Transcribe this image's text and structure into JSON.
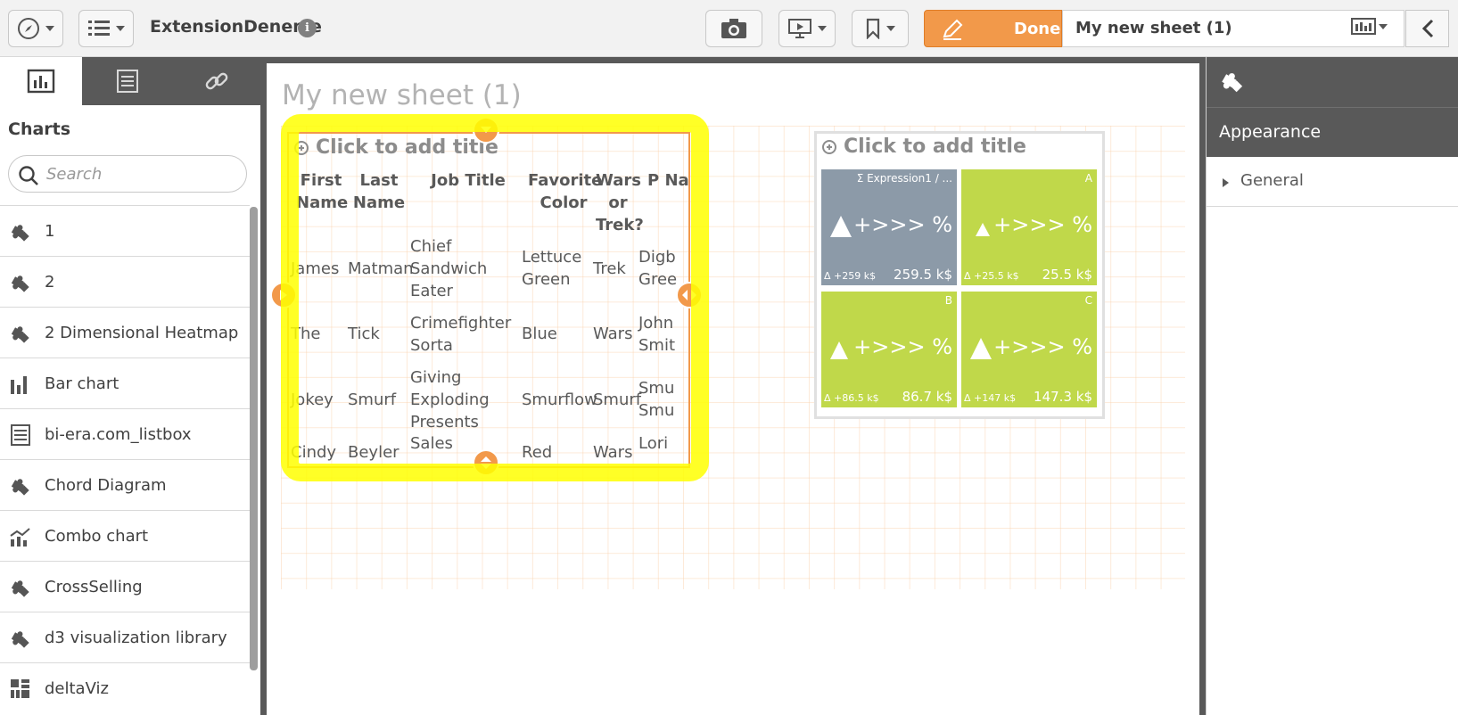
{
  "topbar": {
    "app_title": "ExtensionDeneme",
    "info_glyph": "i",
    "done_label": "Done",
    "sheet_name": "My new sheet (1)"
  },
  "left_panel": {
    "heading": "Charts",
    "search_placeholder": "Search",
    "items": [
      {
        "label": "1",
        "icon": "puzzle-icon"
      },
      {
        "label": "2",
        "icon": "puzzle-icon"
      },
      {
        "label": "2 Dimensional Heatmap",
        "icon": "puzzle-icon"
      },
      {
        "label": "Bar chart",
        "icon": "bar-chart-icon"
      },
      {
        "label": "bi-era.com_listbox",
        "icon": "listbox-icon"
      },
      {
        "label": "Chord Diagram",
        "icon": "puzzle-icon"
      },
      {
        "label": "Combo chart",
        "icon": "combo-chart-icon"
      },
      {
        "label": "CrossSelling",
        "icon": "puzzle-icon"
      },
      {
        "label": "d3 visualization library",
        "icon": "puzzle-icon"
      },
      {
        "label": "deltaViz",
        "icon": "grid-icon"
      }
    ]
  },
  "sheet": {
    "title": "My new sheet (1)",
    "table": {
      "title_placeholder": "Click to add title",
      "headers": [
        "First Name",
        "Last Name",
        "Job Title",
        "Favorite Color",
        "Wars or Trek?",
        "P Na"
      ],
      "rows": [
        [
          "James",
          "Matman",
          "Chief Sandwich Eater",
          "Lettuce Green",
          "Trek",
          "Digb Gree"
        ],
        [
          "The",
          "Tick",
          "Crimefighter Sorta",
          "Blue",
          "Wars",
          "John Smit"
        ],
        [
          "Jokey",
          "Smurf",
          "Giving Exploding Presents",
          "Smurflow",
          "Smurf",
          "Smu Smu"
        ],
        [
          "Cindy",
          "Beyler",
          "Sales",
          "Red",
          "Wars",
          "Lori"
        ]
      ]
    },
    "kpi": {
      "title_placeholder": "Click to add title",
      "tiles": [
        {
          "label": "Σ Expression1 / ...",
          "main": "+>>> %",
          "delta": "Δ +259 k$",
          "value": "259.5 k$",
          "color": "#8c9aa8"
        },
        {
          "label": "A",
          "main": "+>>> %",
          "delta": "Δ +25.5 k$",
          "value": "25.5 k$",
          "color": "#c0d84a"
        },
        {
          "label": "B",
          "main": "+>>> %",
          "delta": "Δ +86.5 k$",
          "value": "86.7 k$",
          "color": "#c0d84a"
        },
        {
          "label": "C",
          "main": "+>>> %",
          "delta": "Δ +147 k$",
          "value": "147.3 k$",
          "color": "#c0d84a"
        }
      ]
    }
  },
  "right_panel": {
    "section": "Appearance",
    "subsection": "General"
  },
  "colors": {
    "accent_orange": "#f2994a",
    "highlight_yellow": "#ffff00",
    "kpi_green": "#c0d84a",
    "kpi_gray": "#8c9aa8",
    "dark_panel": "#595959"
  }
}
